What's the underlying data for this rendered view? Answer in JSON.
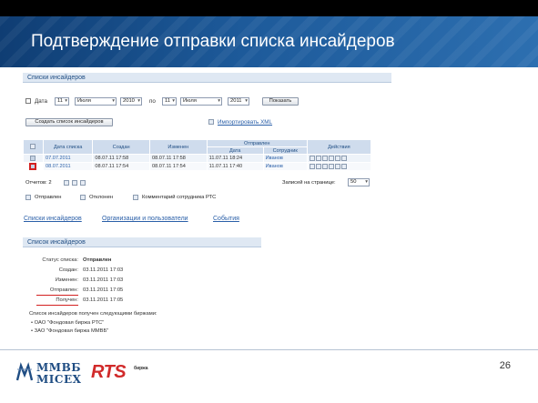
{
  "slide": {
    "title": "Подтверждение отправки списка инсайдеров",
    "page_number": "26",
    "accent_color": "#1d5a9a"
  },
  "lists_section": {
    "heading": "Списки инсайдеров",
    "filter": {
      "date_label": "Дата",
      "from_day": "11",
      "from_month": "Июля",
      "from_year": "2010",
      "to_label": "по",
      "to_day": "11",
      "to_month": "Июля",
      "to_year": "2011",
      "show_button": "Показать"
    },
    "create_button": "Создать список инсайдеров",
    "import_link": "Импортировать XML",
    "table": {
      "headers": {
        "list_date": "Дата списка",
        "created": "Создан",
        "changed": "Изменен",
        "sent": "Отправлен",
        "sent_date": "Дата",
        "sent_employee": "Сотрудник",
        "actions": "Действия"
      },
      "rows": [
        {
          "list_date": "07.07.2011",
          "created": "08.07.11 17:58",
          "changed": "08.07.11 17:58",
          "sent_date": "11.07.11 18:24",
          "employee": "Иванов"
        },
        {
          "list_date": "08.07.2011",
          "created": "08.07.11 17:54",
          "changed": "08.07.11 17:54",
          "sent_date": "11.07.11 17:40",
          "employee": "Иванов"
        }
      ]
    },
    "reports_label": "Отчетов: 2",
    "per_page_label": "Записей на странице:",
    "per_page_value": "50",
    "legend": {
      "sent": "Отправлен",
      "rejected": "Отклонен",
      "comment": "Комментарий сотрудника РТС"
    },
    "nav": {
      "lists": "Списки инсайдеров",
      "orgs": "Организации и пользователи",
      "events": "События"
    }
  },
  "detail_section": {
    "heading": "Список инсайдеров",
    "fields": [
      {
        "key": "Статус списка:",
        "value": "Отправлен"
      },
      {
        "key": "Создан:",
        "value": "03.11.2011 17:03"
      },
      {
        "key": "Изменен:",
        "value": "03.11.2011 17:03"
      },
      {
        "key": "Отправлен:",
        "value": "03.11.2011 17:05"
      },
      {
        "key": "Получен:",
        "value": "03.11.2011 17:05"
      }
    ],
    "received_note": "Список инсайдеров получен следующими биржами:",
    "exchanges": [
      "ОАО \"Фондовая биржа РТС\"",
      "ЗАО \"Фондовая биржа ММВБ\""
    ]
  },
  "footer": {
    "mmvb_line1": "ММВБ",
    "mmvb_line2": "MICEX",
    "rts_big": "RTS",
    "rts_small": "биржа"
  }
}
